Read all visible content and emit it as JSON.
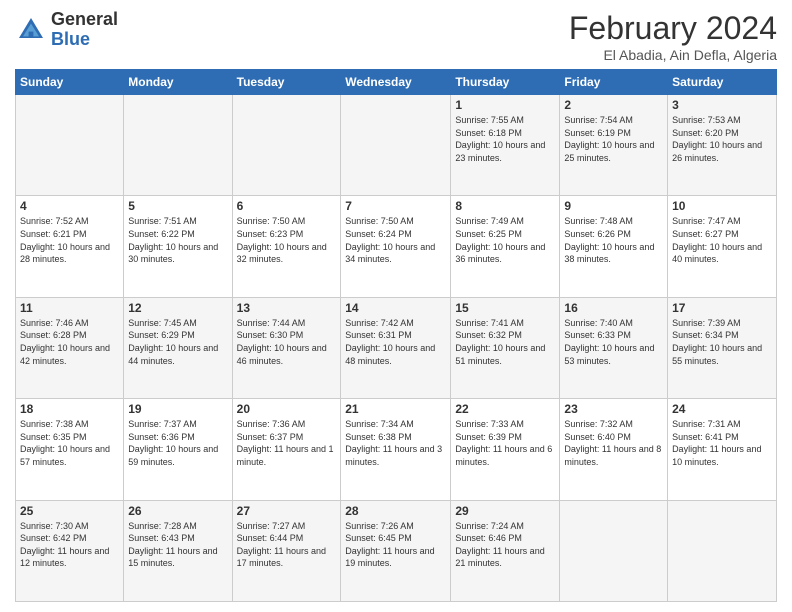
{
  "header": {
    "logo": {
      "general": "General",
      "blue": "Blue"
    },
    "title": "February 2024",
    "location": "El Abadia, Ain Defla, Algeria"
  },
  "weekdays": [
    "Sunday",
    "Monday",
    "Tuesday",
    "Wednesday",
    "Thursday",
    "Friday",
    "Saturday"
  ],
  "weeks": [
    [
      {
        "day": "",
        "sunrise": "",
        "sunset": "",
        "daylight": ""
      },
      {
        "day": "",
        "sunrise": "",
        "sunset": "",
        "daylight": ""
      },
      {
        "day": "",
        "sunrise": "",
        "sunset": "",
        "daylight": ""
      },
      {
        "day": "",
        "sunrise": "",
        "sunset": "",
        "daylight": ""
      },
      {
        "day": "1",
        "sunrise": "Sunrise: 7:55 AM",
        "sunset": "Sunset: 6:18 PM",
        "daylight": "Daylight: 10 hours and 23 minutes."
      },
      {
        "day": "2",
        "sunrise": "Sunrise: 7:54 AM",
        "sunset": "Sunset: 6:19 PM",
        "daylight": "Daylight: 10 hours and 25 minutes."
      },
      {
        "day": "3",
        "sunrise": "Sunrise: 7:53 AM",
        "sunset": "Sunset: 6:20 PM",
        "daylight": "Daylight: 10 hours and 26 minutes."
      }
    ],
    [
      {
        "day": "4",
        "sunrise": "Sunrise: 7:52 AM",
        "sunset": "Sunset: 6:21 PM",
        "daylight": "Daylight: 10 hours and 28 minutes."
      },
      {
        "day": "5",
        "sunrise": "Sunrise: 7:51 AM",
        "sunset": "Sunset: 6:22 PM",
        "daylight": "Daylight: 10 hours and 30 minutes."
      },
      {
        "day": "6",
        "sunrise": "Sunrise: 7:50 AM",
        "sunset": "Sunset: 6:23 PM",
        "daylight": "Daylight: 10 hours and 32 minutes."
      },
      {
        "day": "7",
        "sunrise": "Sunrise: 7:50 AM",
        "sunset": "Sunset: 6:24 PM",
        "daylight": "Daylight: 10 hours and 34 minutes."
      },
      {
        "day": "8",
        "sunrise": "Sunrise: 7:49 AM",
        "sunset": "Sunset: 6:25 PM",
        "daylight": "Daylight: 10 hours and 36 minutes."
      },
      {
        "day": "9",
        "sunrise": "Sunrise: 7:48 AM",
        "sunset": "Sunset: 6:26 PM",
        "daylight": "Daylight: 10 hours and 38 minutes."
      },
      {
        "day": "10",
        "sunrise": "Sunrise: 7:47 AM",
        "sunset": "Sunset: 6:27 PM",
        "daylight": "Daylight: 10 hours and 40 minutes."
      }
    ],
    [
      {
        "day": "11",
        "sunrise": "Sunrise: 7:46 AM",
        "sunset": "Sunset: 6:28 PM",
        "daylight": "Daylight: 10 hours and 42 minutes."
      },
      {
        "day": "12",
        "sunrise": "Sunrise: 7:45 AM",
        "sunset": "Sunset: 6:29 PM",
        "daylight": "Daylight: 10 hours and 44 minutes."
      },
      {
        "day": "13",
        "sunrise": "Sunrise: 7:44 AM",
        "sunset": "Sunset: 6:30 PM",
        "daylight": "Daylight: 10 hours and 46 minutes."
      },
      {
        "day": "14",
        "sunrise": "Sunrise: 7:42 AM",
        "sunset": "Sunset: 6:31 PM",
        "daylight": "Daylight: 10 hours and 48 minutes."
      },
      {
        "day": "15",
        "sunrise": "Sunrise: 7:41 AM",
        "sunset": "Sunset: 6:32 PM",
        "daylight": "Daylight: 10 hours and 51 minutes."
      },
      {
        "day": "16",
        "sunrise": "Sunrise: 7:40 AM",
        "sunset": "Sunset: 6:33 PM",
        "daylight": "Daylight: 10 hours and 53 minutes."
      },
      {
        "day": "17",
        "sunrise": "Sunrise: 7:39 AM",
        "sunset": "Sunset: 6:34 PM",
        "daylight": "Daylight: 10 hours and 55 minutes."
      }
    ],
    [
      {
        "day": "18",
        "sunrise": "Sunrise: 7:38 AM",
        "sunset": "Sunset: 6:35 PM",
        "daylight": "Daylight: 10 hours and 57 minutes."
      },
      {
        "day": "19",
        "sunrise": "Sunrise: 7:37 AM",
        "sunset": "Sunset: 6:36 PM",
        "daylight": "Daylight: 10 hours and 59 minutes."
      },
      {
        "day": "20",
        "sunrise": "Sunrise: 7:36 AM",
        "sunset": "Sunset: 6:37 PM",
        "daylight": "Daylight: 11 hours and 1 minute."
      },
      {
        "day": "21",
        "sunrise": "Sunrise: 7:34 AM",
        "sunset": "Sunset: 6:38 PM",
        "daylight": "Daylight: 11 hours and 3 minutes."
      },
      {
        "day": "22",
        "sunrise": "Sunrise: 7:33 AM",
        "sunset": "Sunset: 6:39 PM",
        "daylight": "Daylight: 11 hours and 6 minutes."
      },
      {
        "day": "23",
        "sunrise": "Sunrise: 7:32 AM",
        "sunset": "Sunset: 6:40 PM",
        "daylight": "Daylight: 11 hours and 8 minutes."
      },
      {
        "day": "24",
        "sunrise": "Sunrise: 7:31 AM",
        "sunset": "Sunset: 6:41 PM",
        "daylight": "Daylight: 11 hours and 10 minutes."
      }
    ],
    [
      {
        "day": "25",
        "sunrise": "Sunrise: 7:30 AM",
        "sunset": "Sunset: 6:42 PM",
        "daylight": "Daylight: 11 hours and 12 minutes."
      },
      {
        "day": "26",
        "sunrise": "Sunrise: 7:28 AM",
        "sunset": "Sunset: 6:43 PM",
        "daylight": "Daylight: 11 hours and 15 minutes."
      },
      {
        "day": "27",
        "sunrise": "Sunrise: 7:27 AM",
        "sunset": "Sunset: 6:44 PM",
        "daylight": "Daylight: 11 hours and 17 minutes."
      },
      {
        "day": "28",
        "sunrise": "Sunrise: 7:26 AM",
        "sunset": "Sunset: 6:45 PM",
        "daylight": "Daylight: 11 hours and 19 minutes."
      },
      {
        "day": "29",
        "sunrise": "Sunrise: 7:24 AM",
        "sunset": "Sunset: 6:46 PM",
        "daylight": "Daylight: 11 hours and 21 minutes."
      },
      {
        "day": "",
        "sunrise": "",
        "sunset": "",
        "daylight": ""
      },
      {
        "day": "",
        "sunrise": "",
        "sunset": "",
        "daylight": ""
      }
    ]
  ]
}
